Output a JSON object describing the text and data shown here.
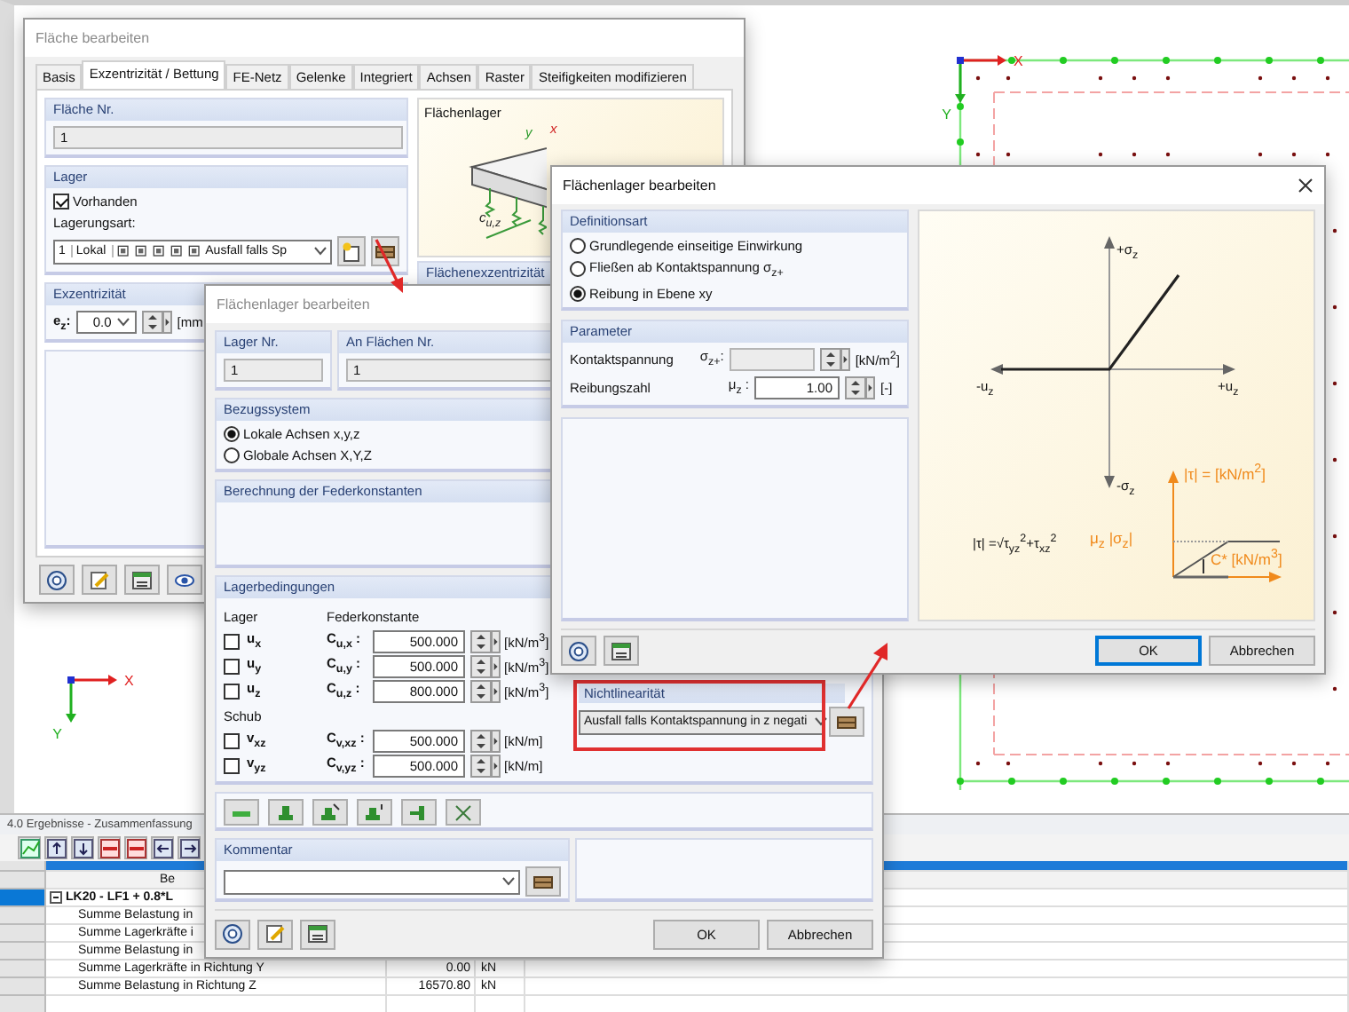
{
  "canvas": {
    "axes": [
      {
        "x_label": "X",
        "y_label": "Y"
      },
      {
        "x_label": "X",
        "y_label": "Y"
      }
    ]
  },
  "results_panel": {
    "title": "4.0 Ergebnisse - Zusammenfassung",
    "table": {
      "column_1": "Be",
      "group_row": {
        "label": "LK20 - LF1 + 0.8*L",
        "expanded": true,
        "selected": true
      },
      "rows": [
        {
          "label": "Summe Belastung in"
        },
        {
          "label": "Summe Lagerkräfte i"
        },
        {
          "label": "Summe Belastung in"
        },
        {
          "label": "Summe Lagerkräfte in Richtung Y",
          "value": "0.00",
          "unit": "kN"
        },
        {
          "label": "Summe Belastung in Richtung Z",
          "value": "16570.80",
          "unit": "kN"
        }
      ]
    }
  },
  "surface_dialog": {
    "title": "Fläche bearbeiten",
    "active": false,
    "tabs": [
      {
        "label": "Basis",
        "selected": false
      },
      {
        "label": "Exzentrizität / Bettung",
        "selected": true
      },
      {
        "label": "FE-Netz",
        "selected": false
      },
      {
        "label": "Gelenke",
        "selected": false
      },
      {
        "label": "Integriert",
        "selected": false
      },
      {
        "label": "Achsen",
        "selected": false
      },
      {
        "label": "Raster",
        "selected": false
      },
      {
        "label": "Steifigkeiten modifizieren",
        "selected": false
      }
    ],
    "surface_no": {
      "label": "Fläche Nr.",
      "value": "1"
    },
    "support": {
      "label": "Lager",
      "present": {
        "label": "Vorhanden",
        "checked": true
      },
      "type_label": "Lagerungsart:",
      "type_combo": {
        "number": "1",
        "system": "Lokal",
        "value": "Ausfall falls Sp"
      }
    },
    "eccentricity": {
      "label": "Exzentrizität",
      "symbol": "e$_{z}$:",
      "value": "0.0",
      "unit": "[mm"
    },
    "preview": {
      "label": "Flächenlager",
      "spring_label": "c$_{u,z}$",
      "x_label": "x",
      "y_label": "y"
    },
    "eccentricity_preview": {
      "label": "Flächenexzentrizität"
    }
  },
  "support_dialog": {
    "title": "Flächenlager bearbeiten",
    "active": false,
    "support_no": {
      "label": "Lager Nr.",
      "value": "1"
    },
    "surfaces": {
      "label": "An Flächen Nr.",
      "value": "1"
    },
    "reference_system": {
      "label": "Bezugssystem",
      "options": [
        {
          "label": "Lokale Achsen x,y,z",
          "selected": true
        },
        {
          "label": "Globale Achsen X,Y,Z",
          "selected": false
        }
      ]
    },
    "spring_calc": {
      "label": "Berechnung der Federkonstanten"
    },
    "conditions": {
      "label": "Lagerbedingungen",
      "support_label": "Lager",
      "spring_label": "Federkonstante",
      "shear_label": "Schub",
      "support_rows": [
        {
          "dof": "u$_{x}$",
          "checked": false,
          "symbol": "C$_{u,x}$ :",
          "value": "500.000",
          "unit": "[kN/m$^{3}$]"
        },
        {
          "dof": "u$_{y}$",
          "checked": false,
          "symbol": "C$_{u,y}$ :",
          "value": "500.000",
          "unit": "[kN/m$^{3}$]"
        },
        {
          "dof": "u$_{z}$",
          "checked": false,
          "symbol": "C$_{u,z}$ :",
          "value": "800.000",
          "unit": "[kN/m$^{3}$]"
        }
      ],
      "shear_rows": [
        {
          "dof": "v$_{xz}$",
          "checked": false,
          "symbol": "C$_{v,xz}$ :",
          "value": "500.000",
          "unit": "[kN/m]"
        },
        {
          "dof": "v$_{yz}$",
          "checked": false,
          "symbol": "C$_{v,yz}$ :",
          "value": "500.000",
          "unit": "[kN/m]"
        }
      ]
    },
    "nonlinearity": {
      "label": "Nichtlinearität",
      "value": "Ausfall falls Kontaktspannung in z negati",
      "highlighted": true
    },
    "comment": {
      "label": "Kommentar"
    },
    "buttons": [
      "OK",
      "Abbrechen"
    ]
  },
  "nonlinear_dialog": {
    "title": "Flächenlager bearbeiten",
    "active": true,
    "definition": {
      "label": "Definitionsart",
      "options": [
        {
          "label": "Grundlegende einseitige Einwirkung",
          "selected": false
        },
        {
          "label": "Fließen ab Kontaktspannung σ$_{z+}$",
          "selected": false
        },
        {
          "label": "Reibung in Ebene xy",
          "selected": true
        }
      ]
    },
    "parameters": {
      "label": "Parameter",
      "rows": [
        {
          "label": "Kontaktspannung",
          "symbol": "σ$_{z+}$:",
          "disabled": true,
          "unit": "[kN/m$^{2}$]"
        },
        {
          "label": "Reibungszahl",
          "symbol": "μ$_{z}$ :",
          "value": "1.00",
          "disabled": false,
          "unit": "[-]"
        }
      ]
    },
    "diagram": {
      "plus_sigma": "+σ$_{z}$",
      "minus_u": "-u$_{z}$",
      "plus_u": "+u$_{z}$",
      "minus_sigma": "-σ$_{z}$",
      "formula": "|τ| =√τ$_{yz}$$^{2}$+τ$_{xz}$$^{2}$",
      "tau_unit": "|τ| = [kN/m$^{2}$]",
      "mu_sigma": "μ$_{z}$ |σ$_{z}$|",
      "stiffness": "C* [kN/m$^{3}$]"
    },
    "buttons": [
      {
        "label": "OK",
        "default": true
      },
      {
        "label": "Abbrechen",
        "default": false
      }
    ]
  }
}
